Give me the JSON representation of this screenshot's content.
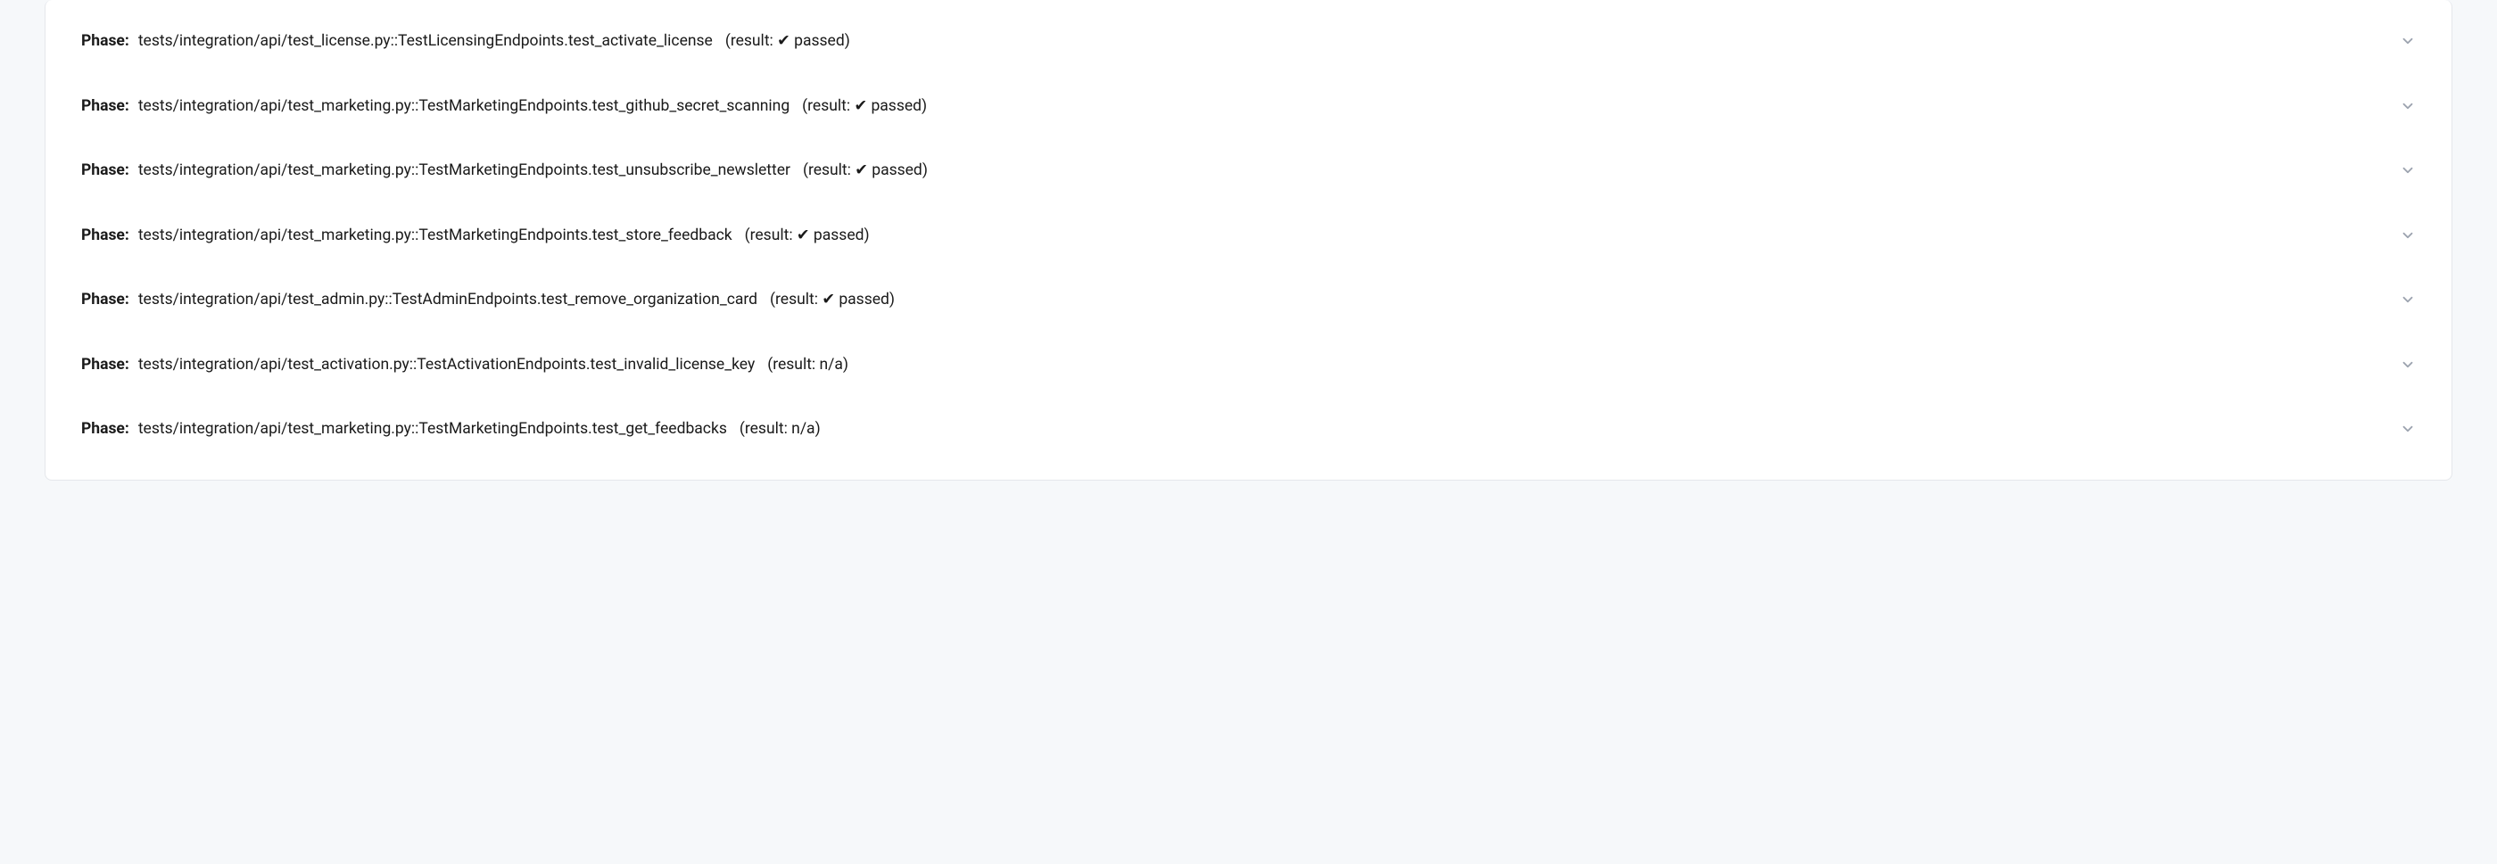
{
  "phaseLabel": "Phase:",
  "resultPrefix": "(result: ",
  "resultSuffix": ")",
  "passedText": " passed",
  "checkmark": "✔",
  "phases": [
    {
      "test": "tests/integration/api/test_license.py::TestLicensingEndpoints.test_activate_license",
      "result": "passed"
    },
    {
      "test": "tests/integration/api/test_marketing.py::TestMarketingEndpoints.test_github_secret_scanning",
      "result": "passed"
    },
    {
      "test": "tests/integration/api/test_marketing.py::TestMarketingEndpoints.test_unsubscribe_newsletter",
      "result": "passed"
    },
    {
      "test": "tests/integration/api/test_marketing.py::TestMarketingEndpoints.test_store_feedback",
      "result": "passed"
    },
    {
      "test": "tests/integration/api/test_admin.py::TestAdminEndpoints.test_remove_organization_card",
      "result": "passed"
    },
    {
      "test": "tests/integration/api/test_activation.py::TestActivationEndpoints.test_invalid_license_key",
      "result": "n/a"
    },
    {
      "test": "tests/integration/api/test_marketing.py::TestMarketingEndpoints.test_get_feedbacks",
      "result": "n/a"
    }
  ]
}
